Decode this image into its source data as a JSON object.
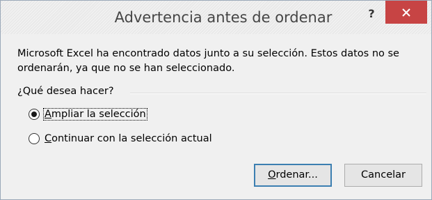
{
  "dialog": {
    "title": "Advertencia antes de ordenar",
    "help_label": "?",
    "message": "Microsoft Excel ha encontrado datos junto a su selección. Estos datos no se ordenarán, ya que no se han seleccionado.",
    "question": "¿Qué desea hacer?",
    "options": [
      {
        "mnemonic": "A",
        "rest": "mpliar la selección",
        "selected": true
      },
      {
        "mnemonic": "C",
        "rest": "ontinuar con la selección actual",
        "selected": false
      }
    ],
    "buttons": {
      "ok": {
        "mnemonic": "O",
        "rest": "rdenar..."
      },
      "cancel": {
        "label": "Cancelar"
      }
    },
    "colors": {
      "close_button": "#c74444",
      "default_button_border": "#3c7fb1"
    }
  }
}
